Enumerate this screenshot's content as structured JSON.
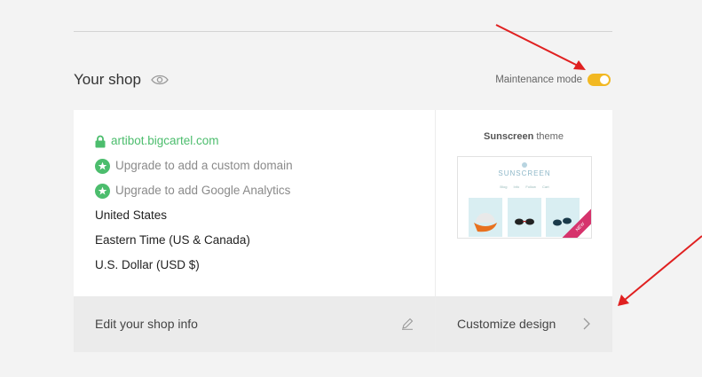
{
  "header": {
    "shop_title": "Your shop",
    "maintenance_label": "Maintenance mode",
    "maintenance_on": true
  },
  "shop_info": {
    "domain": "artibot.bigcartel.com",
    "upgrade_domain": "Upgrade to add a custom domain",
    "upgrade_analytics": "Upgrade to add Google Analytics",
    "country": "United States",
    "timezone": "Eastern Time (US & Canada)",
    "currency": "U.S. Dollar (USD $)"
  },
  "theme": {
    "name": "Sunscreen",
    "suffix": "theme",
    "thumb_logo": "SUNSCREEN",
    "thumb_nav": "Blog Info Follow Cart",
    "thumb_ribbon": "NEW"
  },
  "footer": {
    "edit_label": "Edit your shop info",
    "customize_label": "Customize design"
  },
  "colors": {
    "accent_green": "#4cbd6d",
    "toggle_yellow": "#f2b822",
    "annotation_red": "#e02020"
  }
}
